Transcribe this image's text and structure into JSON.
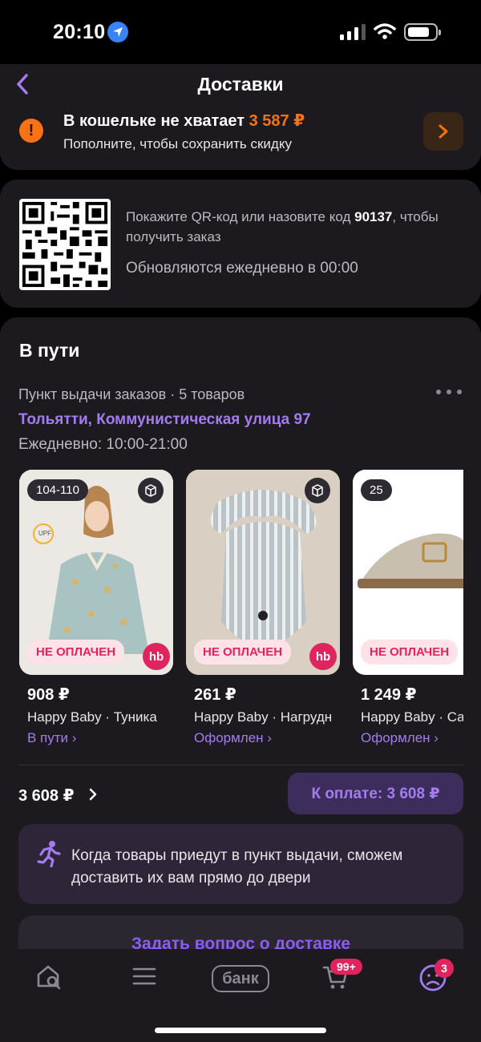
{
  "status_bar": {
    "time": "20:10"
  },
  "header": {
    "title": "Доставки"
  },
  "wallet": {
    "warn_label": "В кошельке не хватает",
    "amount": "3 587 ₽",
    "subtitle": "Пополните, чтобы сохранить скидку"
  },
  "qr": {
    "text_before": "Покажите QR-код или назовите код",
    "code": "90137",
    "text_after": ", чтобы получить заказ",
    "update_note": "Обновляются ежедневно в 00:00"
  },
  "order": {
    "title": "В пути",
    "pickup_meta": "Пункт выдачи заказов · 5 товаров",
    "address": "Тольятти, Коммунистическая улица 97",
    "hours": "Ежедневно: 10:00-21:00",
    "products": [
      {
        "badge": "104-110",
        "unpaid": "НЕ ОПЛАЧЕН",
        "price": "908 ₽",
        "name": "Happy Baby · Туника",
        "status": "В пути ›",
        "brand_logo": "hb"
      },
      {
        "badge": "",
        "unpaid": "НЕ ОПЛАЧЕН",
        "price": "261 ₽",
        "name": "Happy Baby · Нагрудник",
        "status": "Оформлен ›",
        "brand_logo": "hb"
      },
      {
        "badge": "25",
        "unpaid": "НЕ ОПЛАЧЕН",
        "price": "1 249 ₽",
        "name": "Happy Baby · Сандалии",
        "status": "Оформлен ›",
        "brand_logo": ""
      }
    ],
    "total": "3 608 ₽",
    "pay_button": "К оплате: 3 608 ₽",
    "info": "Когда товары приедут в пункт выдачи, сможем доставить их вам прямо до двери",
    "ask_button": "Задать вопрос о доставке"
  },
  "tabbar": {
    "bank_label": "банк",
    "cart_badge": "99+",
    "profile_badge": "3"
  },
  "colors": {
    "accent": "#a37cf0",
    "warning": "#f97316",
    "unpaid": "#e0245e",
    "card_bg": "#1c191f"
  },
  "icons": [
    "back-arrow-icon",
    "warning-icon",
    "chevron-right-icon",
    "qr-code-icon",
    "package-return-icon",
    "more-dots-icon",
    "running-person-icon",
    "home-search-icon",
    "menu-icon",
    "cart-icon",
    "profile-icon"
  ]
}
